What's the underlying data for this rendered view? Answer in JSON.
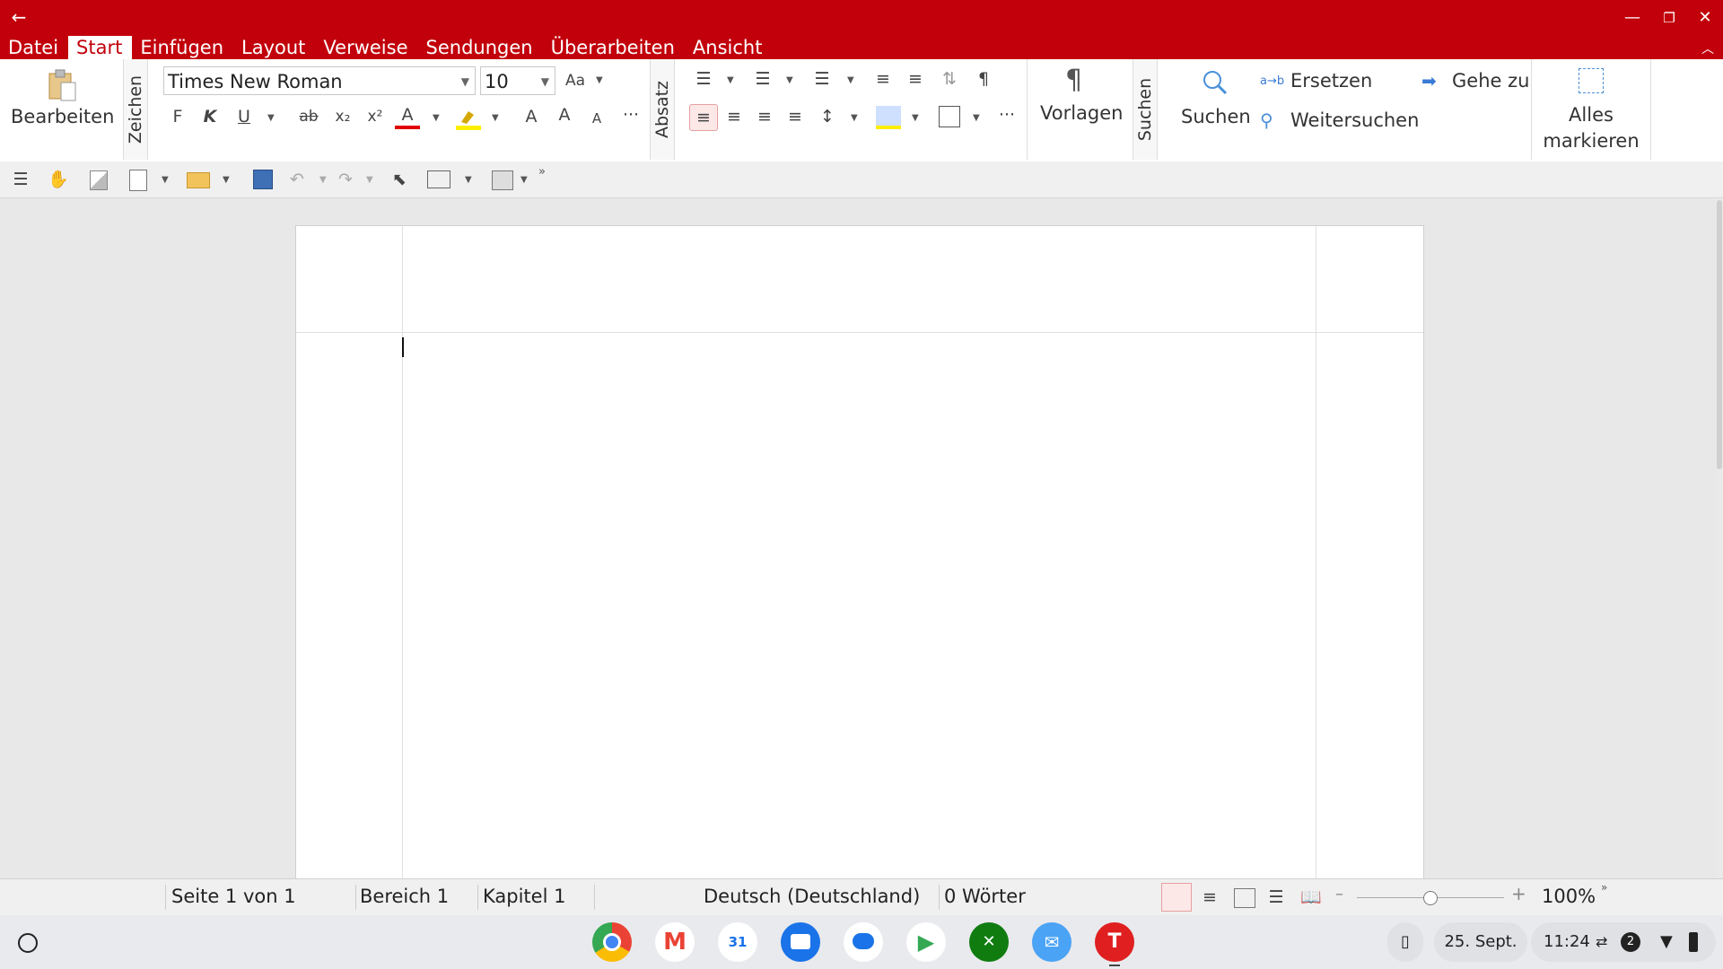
{
  "window": {
    "back_icon": "arrow-left-icon",
    "minimize_icon": "minimize-icon",
    "restore_icon": "restore-icon",
    "close_icon": "close-icon"
  },
  "menu": [
    "Datei",
    "Start",
    "Einfügen",
    "Layout",
    "Verweise",
    "Sendungen",
    "Überarbeiten",
    "Ansicht"
  ],
  "menu_active": "Start",
  "ribbon": {
    "edit_label": "Bearbeiten",
    "group_zeichen": "Zeichen",
    "font_name": "Times New Roman",
    "font_size": "10",
    "bold": "F",
    "italic": "K",
    "underline": "U",
    "subscript": "x₂",
    "superscript": "x²",
    "font_color_letter": "A",
    "group_absatz": "Absatz",
    "styles_label": "Vorlagen",
    "group_suchen": "Suchen",
    "search_label": "Suchen",
    "replace_label": "Ersetzen",
    "find_next_label": "Weitersuchen",
    "goto_label": "Gehe zu",
    "select_all_line1": "Alles",
    "select_all_line2": "markieren"
  },
  "status": {
    "page": "Seite 1 von 1",
    "section": "Bereich 1",
    "chapter": "Kapitel 1",
    "language": "Deutsch (Deutschland)",
    "words": "0 Wörter",
    "zoom": "100%",
    "zoom_level": 0.5
  },
  "shelf": {
    "apps": [
      "chrome",
      "gmail",
      "calendar",
      "files",
      "messages",
      "play-store",
      "game-pass",
      "mail",
      "textmaker"
    ],
    "calendar_day": "31",
    "date": "25. Sept.",
    "time": "11:24",
    "notification_count": "2"
  },
  "colors": {
    "accent": "#c2000b",
    "highlight": "#ffee00"
  }
}
